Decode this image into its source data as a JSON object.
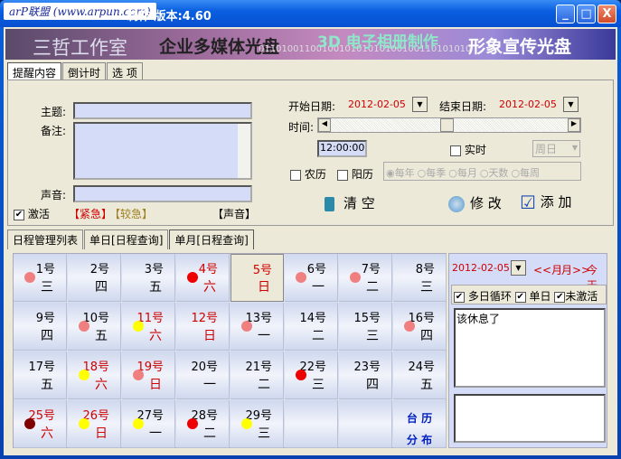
{
  "titlebar": {
    "logo": "arP联盟 (www.arpun.com)",
    "title": "制作  版本:4.60",
    "min": "_",
    "max": "□",
    "close": "X"
  },
  "banner": {
    "studio": "三哲工作室",
    "t1": "企业多媒体光盘",
    "t2": "3D 电子相册制作",
    "t3": "形象宣传光盘",
    "binary": "0110100110010010101010100100110101010"
  },
  "top_tabs": [
    "提醒内容",
    "倒计时",
    "选 项"
  ],
  "form": {
    "subject_label": "主题:",
    "notes_label": "备注:",
    "sound_label": "声音:",
    "activate_label": "激活",
    "urgent": "【紧急】",
    "less_urgent": "【较急】",
    "sound_btn": "【声音】",
    "start_label": "开始日期:",
    "start_date": "2012-02-05",
    "end_label": "结束日期:",
    "end_date": "2012-02-05",
    "time_label": "时间:",
    "time_value": "12:00:00",
    "realtime_label": "实时",
    "weekday_value": "周日",
    "lunar_label": "农历",
    "solar_label": "阳历",
    "repeat_options": [
      "每年",
      "每季",
      "每月",
      "天数",
      "每周"
    ],
    "clear_btn": "清 空",
    "modify_btn": "修 改",
    "add_btn": "添 加"
  },
  "bottom_tabs": [
    "日程管理列表",
    "单日[日程查询]",
    "单月[日程查询]"
  ],
  "colors": {
    "pink": "#f08080",
    "red": "#ee0000",
    "yellow": "#ffff00",
    "darkred": "#800000"
  },
  "calendar": {
    "days": [
      [
        "1号",
        "三",
        0,
        "pink"
      ],
      [
        "2号",
        "四",
        0,
        ""
      ],
      [
        "3号",
        "五",
        0,
        ""
      ],
      [
        "4号",
        "六",
        1,
        "red"
      ],
      [
        "5号",
        "日",
        1,
        ""
      ],
      [
        "6号",
        "一",
        0,
        "pink"
      ],
      [
        "7号",
        "二",
        0,
        "pink"
      ],
      [
        "8号",
        "三",
        0,
        ""
      ],
      [
        "9号",
        "四",
        0,
        ""
      ],
      [
        "10号",
        "五",
        0,
        "pink"
      ],
      [
        "11号",
        "六",
        1,
        "yellow"
      ],
      [
        "12号",
        "日",
        1,
        ""
      ],
      [
        "13号",
        "一",
        0,
        "pink"
      ],
      [
        "14号",
        "二",
        0,
        ""
      ],
      [
        "15号",
        "三",
        0,
        ""
      ],
      [
        "16号",
        "四",
        0,
        "pink"
      ],
      [
        "17号",
        "五",
        0,
        ""
      ],
      [
        "18号",
        "六",
        1,
        "yellow"
      ],
      [
        "19号",
        "日",
        1,
        "pink"
      ],
      [
        "20号",
        "一",
        0,
        ""
      ],
      [
        "21号",
        "二",
        0,
        ""
      ],
      [
        "22号",
        "三",
        0,
        "red"
      ],
      [
        "23号",
        "四",
        0,
        ""
      ],
      [
        "24号",
        "五",
        0,
        ""
      ],
      [
        "25号",
        "六",
        1,
        "darkred"
      ],
      [
        "26号",
        "日",
        1,
        "yellow"
      ],
      [
        "27号",
        "一",
        0,
        "yellow"
      ],
      [
        "28号",
        "二",
        0,
        "red"
      ],
      [
        "29号",
        "三",
        0,
        "yellow"
      ]
    ],
    "dist1": "台 历",
    "dist2": "分 布"
  },
  "side": {
    "date": "2012-02-05",
    "prev": "<<月",
    "next": "月>>",
    "today": "今天",
    "multi": "多日循环",
    "single": "单日",
    "inactive": "未激活",
    "note": "该休息了"
  }
}
